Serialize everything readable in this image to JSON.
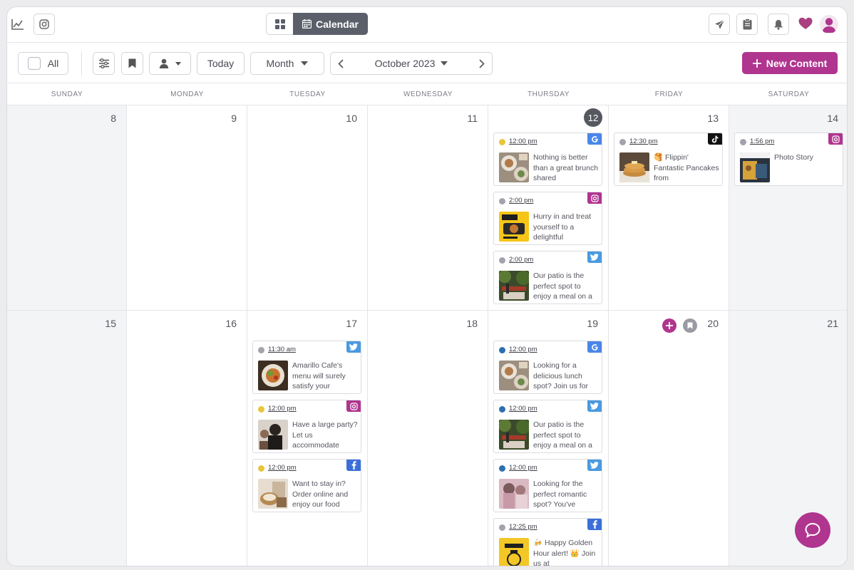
{
  "header": {
    "view_calendar_label": "Calendar"
  },
  "toolbar": {
    "all_label": "All",
    "today_label": "Today",
    "view_label": "Month",
    "month_label": "October 2023",
    "new_content_label": "New Content"
  },
  "weekdays": [
    "SUNDAY",
    "MONDAY",
    "TUESDAY",
    "WEDNESDAY",
    "THURSDAY",
    "FRIDAY",
    "SATURDAY"
  ],
  "week1": {
    "days": [
      "8",
      "9",
      "10",
      "11",
      "12",
      "13",
      "14"
    ]
  },
  "week2": {
    "days": [
      "15",
      "16",
      "17",
      "18",
      "19",
      "20",
      "21"
    ]
  },
  "today": "12",
  "posts": {
    "thu12_1": {
      "time": "12:00 pm",
      "text": "Nothing is better than a great brunch shared",
      "network": "google",
      "status_color": "#e8c53a"
    },
    "thu12_2": {
      "time": "2:00 pm",
      "text": "Hurry in and treat yourself to a delightful",
      "network": "instagram",
      "status_color": "#a3a3ad"
    },
    "thu12_3": {
      "time": "2:00 pm",
      "text": "Our patio is the perfect spot to enjoy a meal on a",
      "network": "twitter",
      "status_color": "#a3a3ad"
    },
    "fri13_1": {
      "time": "12:30 pm",
      "text": "🥞 Flippin' Fantastic Pancakes from",
      "network": "tiktok",
      "status_color": "#a3a3ad"
    },
    "sat14_1": {
      "time": "1:56 pm",
      "text": "Photo Story",
      "network": "instagram",
      "status_color": "#a3a3ad"
    },
    "tue17_1": {
      "time": "11:30 am",
      "text": "Amarillo Cafe's menu will surely satisfy your",
      "network": "twitter",
      "status_color": "#a3a3ad"
    },
    "tue17_2": {
      "time": "12:00 pm",
      "text": "Have a large party? Let us accommodate",
      "network": "instagram",
      "status_color": "#e8c53a"
    },
    "tue17_3": {
      "time": "12:00 pm",
      "text": "Want to stay in? Order online and enjoy our food",
      "network": "facebook",
      "status_color": "#e8c53a"
    },
    "thu19_1": {
      "time": "12:00 pm",
      "text": "Looking for a delicious lunch spot? Join us for",
      "network": "google",
      "status_color": "#2d6fb0"
    },
    "thu19_2": {
      "time": "12:00 pm",
      "text": "Our patio is the perfect spot to enjoy a meal on a",
      "network": "twitter",
      "status_color": "#2d6fb0"
    },
    "thu19_3": {
      "time": "12:00 pm",
      "text": "Looking for the perfect romantic spot? You've",
      "network": "twitter",
      "status_color": "#2d6fb0"
    },
    "thu19_4": {
      "time": "12:25 pm",
      "text": "🍻 Happy Golden Hour alert! 👑 Join us at",
      "network": "facebook",
      "status_color": "#a3a3ad"
    }
  },
  "colors": {
    "brand": "#b0358f",
    "google": "#4a86e8",
    "instagram": "#b0358f",
    "twitter": "#4a9ae0",
    "facebook": "#3b6fd8",
    "tiktok": "#111111"
  }
}
